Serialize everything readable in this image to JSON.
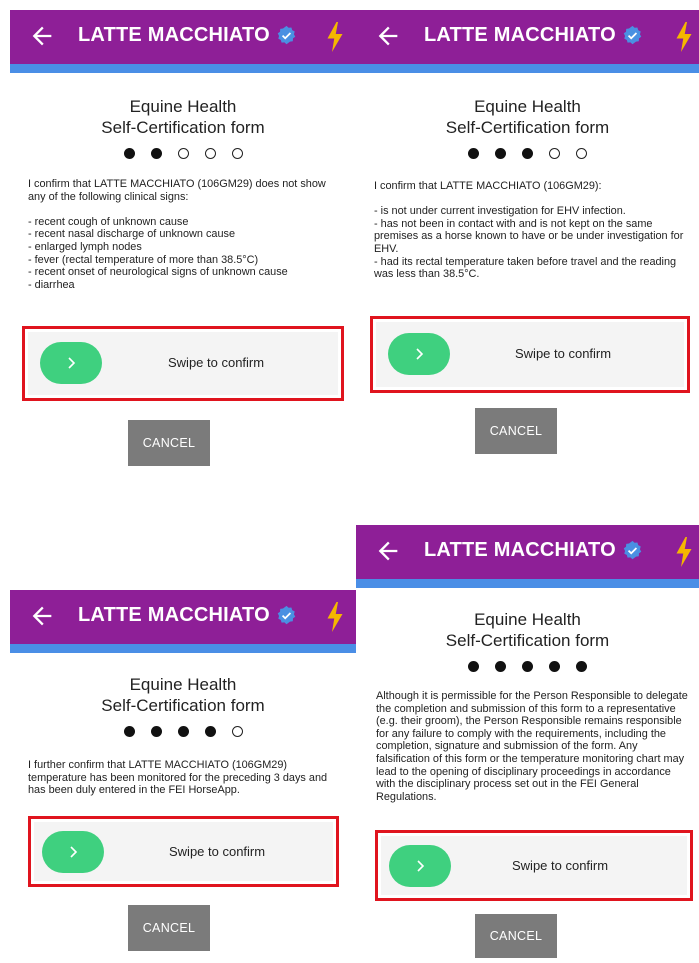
{
  "app": {
    "title": "LATTE MACCHIATO",
    "colors": {
      "appbar": "#8e1f97",
      "stripe": "#4a8ee6",
      "verified": "#4a90e2",
      "bolt": "#f5b700",
      "swipe_handle": "#3fd07f",
      "highlight": "#e0141e",
      "cancel": "#7b7b7b"
    },
    "icons": [
      "back-arrow-icon",
      "verified-badge-icon",
      "lightning-bolt-icon",
      "chevron-right-icon"
    ]
  },
  "form": {
    "heading_line1": "Equine Health",
    "heading_line2": "Self-Certification form",
    "swipe_label": "Swipe to confirm",
    "cancel_label": "CANCEL"
  },
  "steps": [
    {
      "step": 2,
      "total": 5,
      "text": "I confirm that LATTE MACCHIATO (106GM29) does not show any of the following clinical signs:\n\n- recent cough of unknown cause\n- recent nasal discharge of unknown cause\n- enlarged lymph nodes\n- fever (rectal temperature of more than 38.5°C)\n- recent onset of neurological signs of unknown cause\n- diarrhea"
    },
    {
      "step": 3,
      "total": 5,
      "text": "I confirm that LATTE MACCHIATO (106GM29):\n\n- is not under current investigation for EHV infection.\n- has not been in contact with and is not kept on the same premises as a horse known to have or be under investigation for EHV.\n- had its rectal temperature taken before travel and the reading was less than 38.5°C."
    },
    {
      "step": 4,
      "total": 5,
      "text": "I further confirm that LATTE MACCHIATO (106GM29) temperature has been monitored for the preceding 3 days and has been duly entered in the FEI HorseApp."
    },
    {
      "step": 5,
      "total": 5,
      "text": "Although it is permissible for the Person Responsible to delegate the completion and submission of this form to a representative (e.g. their groom), the Person Responsible remains responsible for any failure to comply with the requirements, including the completion, signature and submission of the form. Any falsification of this form or the temperature monitoring chart may lead to the opening of disciplinary proceedings in accordance with the disciplinary process set out in the FEI General Regulations."
    }
  ]
}
